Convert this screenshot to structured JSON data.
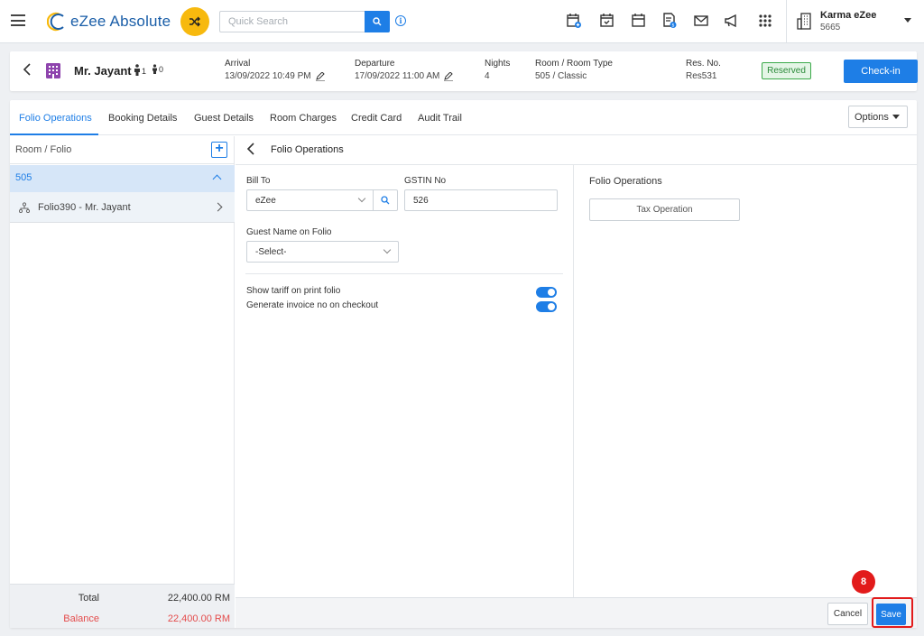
{
  "brand": {
    "name": "eZee Absolute"
  },
  "search": {
    "placeholder": "Quick Search"
  },
  "user": {
    "name": "Karma eZee",
    "code": "5665"
  },
  "reservation": {
    "guest_name": "Mr. Jayant",
    "adults": "1",
    "children": "0",
    "arrival_label": "Arrival",
    "arrival_value": "13/09/2022 10:49 PM",
    "departure_label": "Departure",
    "departure_value": "17/09/2022 11:00 AM",
    "nights_label": "Nights",
    "nights_value": "4",
    "room_label": "Room / Room Type",
    "room_value": "505 / Classic",
    "resno_label": "Res. No.",
    "resno_value": "Res531",
    "status": "Reserved",
    "checkin_label": "Check-in"
  },
  "tabs": [
    {
      "label": "Folio Operations"
    },
    {
      "label": "Booking Details"
    },
    {
      "label": "Guest Details"
    },
    {
      "label": "Room Charges"
    },
    {
      "label": "Credit Card"
    },
    {
      "label": "Audit Trail"
    }
  ],
  "options_label": "Options",
  "left_panel": {
    "header": "Room / Folio",
    "add_symbol": "+",
    "room": "505",
    "folio": "Folio390 - Mr. Jayant",
    "total_label": "Total",
    "total_value": "22,400.00 RM",
    "balance_label": "Balance",
    "balance_value": "22,400.00 RM"
  },
  "folio_ops": {
    "title": "Folio Operations",
    "bill_to_label": "Bill To",
    "bill_to_value": "eZee",
    "gstin_label": "GSTIN No",
    "gstin_value": "526",
    "guest_name_label": "Guest Name on Folio",
    "guest_name_value": "-Select-",
    "toggle_1_label": "Show tariff on print folio",
    "toggle_1_on": true,
    "toggle_2_label": "Generate invoice no on checkout",
    "toggle_2_on": true,
    "right_title": "Folio Operations",
    "tax_operation_label": "Tax Operation"
  },
  "footer": {
    "cancel_label": "Cancel",
    "save_label": "Save"
  },
  "annotation": {
    "step_number": "8"
  },
  "colors": {
    "primary": "#1e7ee6",
    "accent": "#f7b90e",
    "success": "#3ba94a",
    "danger": "#e44b4b",
    "annotation": "#e21b1b"
  }
}
